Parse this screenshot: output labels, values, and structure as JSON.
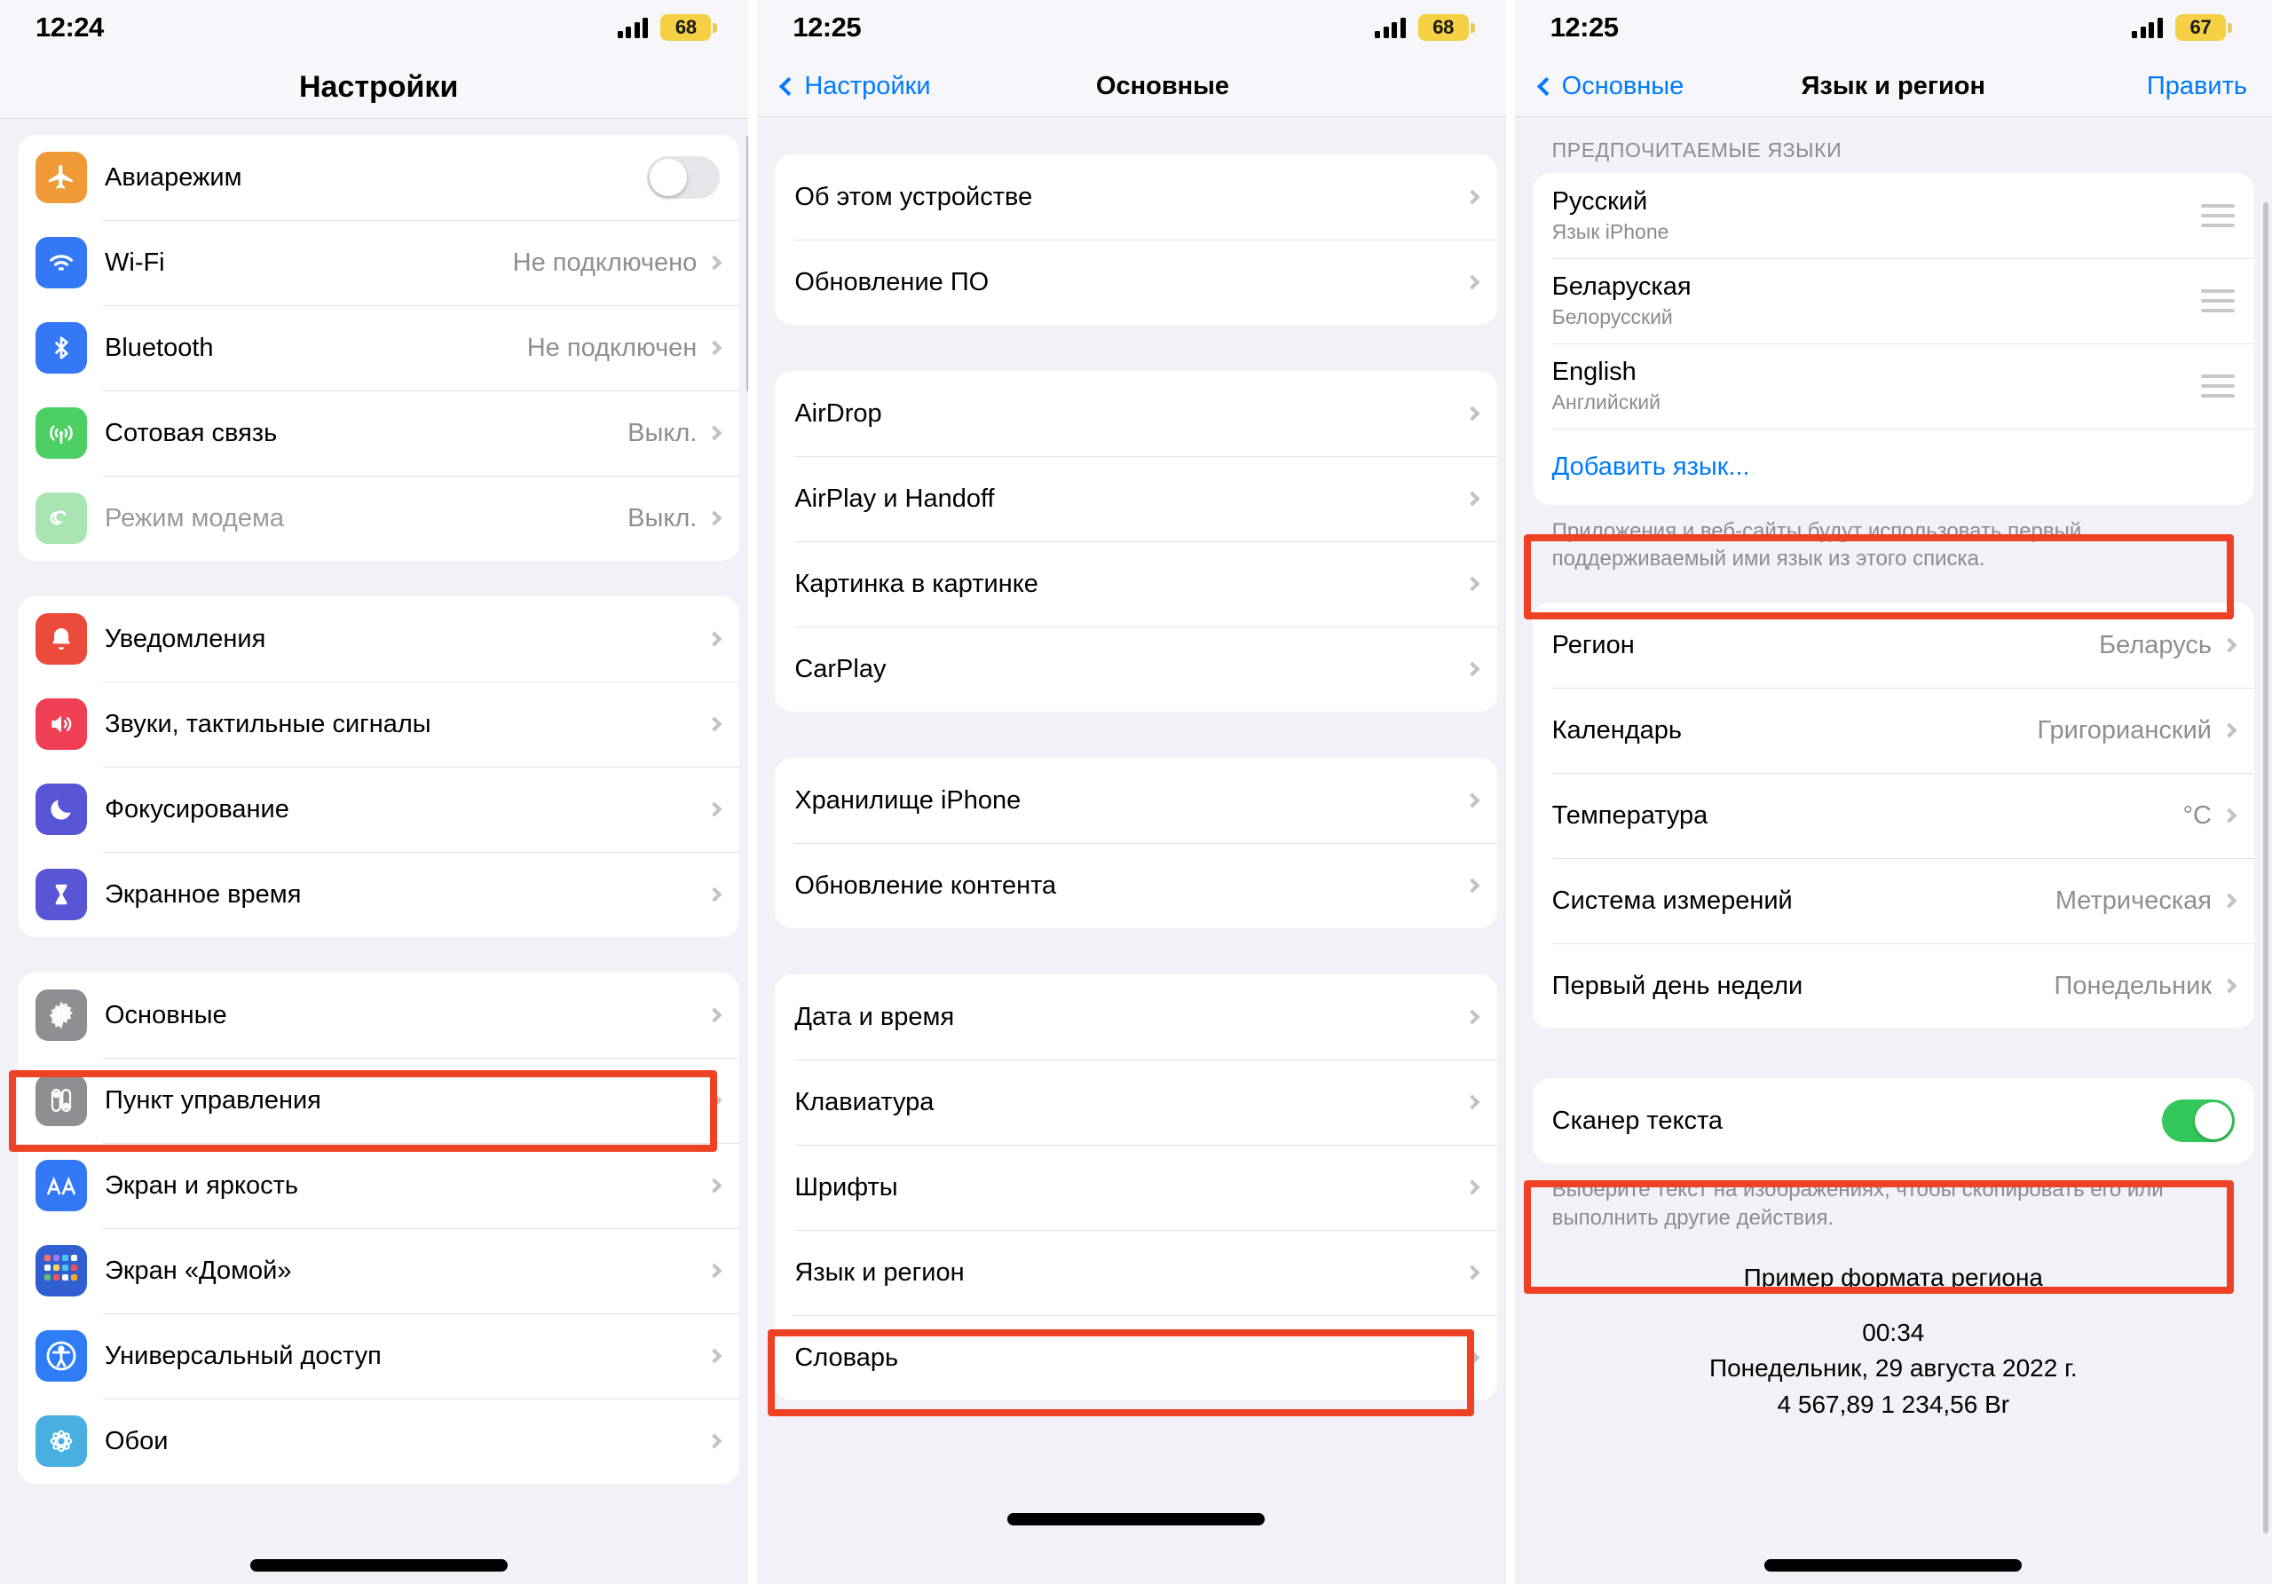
{
  "panels": [
    {
      "id": "settings-root",
      "status": {
        "time": "12:24",
        "battery": "68"
      },
      "nav": {
        "title": "Настройки"
      },
      "groups": [
        {
          "rows": [
            {
              "icon": "airplane-icon",
              "icon_color": "#f09a37",
              "label": "Авиарежим",
              "control": "toggle",
              "toggle_on": false
            },
            {
              "icon": "wifi-icon",
              "icon_color": "#3478f6",
              "label": "Wi-Fi",
              "value": "Не подключено",
              "control": "chevron"
            },
            {
              "icon": "bluetooth-icon",
              "icon_color": "#3478f6",
              "label": "Bluetooth",
              "value": "Не подключен",
              "control": "chevron"
            },
            {
              "icon": "cellular-icon",
              "icon_color": "#4cd063",
              "label": "Сотовая связь",
              "value": "Выкл.",
              "control": "chevron"
            },
            {
              "icon": "hotspot-icon",
              "icon_color": "#a8e5b2",
              "label": "Режим модема",
              "value": "Выкл.",
              "control": "chevron",
              "dim": true
            }
          ]
        },
        {
          "rows": [
            {
              "icon": "bell-icon",
              "icon_color": "#eb4b3b",
              "label": "Уведомления",
              "control": "chevron"
            },
            {
              "icon": "speaker-icon",
              "icon_color": "#ef4056",
              "label": "Звуки, тактильные сигналы",
              "control": "chevron"
            },
            {
              "icon": "moon-icon",
              "icon_color": "#5956d6",
              "label": "Фокусирование",
              "control": "chevron"
            },
            {
              "icon": "hourglass-icon",
              "icon_color": "#5956d6",
              "label": "Экранное время",
              "control": "chevron"
            }
          ]
        },
        {
          "rows": [
            {
              "icon": "gear-icon",
              "icon_color": "#8e8e93",
              "label": "Основные",
              "control": "chevron",
              "highlight": true
            },
            {
              "icon": "control-center-icon",
              "icon_color": "#8e8e93",
              "label": "Пункт управления",
              "control": "chevron"
            },
            {
              "icon": "display-icon",
              "icon_color": "#3478f6",
              "label": "Экран и яркость",
              "control": "chevron"
            },
            {
              "icon": "home-screen-icon",
              "icon_color": "#2f5fd0",
              "label": "Экран «Домой»",
              "control": "chevron"
            },
            {
              "icon": "accessibility-icon",
              "icon_color": "#2f7df6",
              "label": "Универсальный доступ",
              "control": "chevron"
            },
            {
              "icon": "wallpaper-icon",
              "icon_color": "#48b0e0",
              "label": "Обои",
              "control": "chevron"
            }
          ]
        }
      ]
    },
    {
      "id": "general",
      "status": {
        "time": "12:25",
        "battery": "68"
      },
      "nav": {
        "back": "Настройки",
        "title": "Основные"
      },
      "groups": [
        {
          "rows": [
            {
              "label": "Об этом устройстве",
              "control": "chevron"
            },
            {
              "label": "Обновление ПО",
              "control": "chevron"
            }
          ]
        },
        {
          "rows": [
            {
              "label": "AirDrop",
              "control": "chevron"
            },
            {
              "label": "AirPlay и Handoff",
              "control": "chevron"
            },
            {
              "label": "Картинка в картинке",
              "control": "chevron"
            },
            {
              "label": "CarPlay",
              "control": "chevron"
            }
          ]
        },
        {
          "rows": [
            {
              "label": "Хранилище iPhone",
              "control": "chevron"
            },
            {
              "label": "Обновление контента",
              "control": "chevron"
            }
          ]
        },
        {
          "rows": [
            {
              "label": "Дата и время",
              "control": "chevron"
            },
            {
              "label": "Клавиатура",
              "control": "chevron"
            },
            {
              "label": "Шрифты",
              "control": "chevron"
            },
            {
              "label": "Язык и регион",
              "control": "chevron",
              "highlight": true
            },
            {
              "label": "Словарь",
              "control": "chevron"
            }
          ]
        }
      ]
    },
    {
      "id": "language-region",
      "status": {
        "time": "12:25",
        "battery": "67"
      },
      "nav": {
        "back": "Основные",
        "title": "Язык и регион",
        "right": "Править"
      },
      "section_header": "ПРЕДПОЧИТАЕМЫЕ ЯЗЫКИ",
      "languages": [
        {
          "name": "Русский",
          "sub": "Язык iPhone"
        },
        {
          "name": "Беларуская",
          "sub": "Белорусский"
        },
        {
          "name": "English",
          "sub": "Английский"
        }
      ],
      "add_language": "Добавить язык...",
      "languages_footer": "Приложения и веб-сайты будут использовать первый поддерживаемый ими язык из этого списка.",
      "region_rows": [
        {
          "label": "Регион",
          "value": "Беларусь"
        },
        {
          "label": "Календарь",
          "value": "Григорианский"
        },
        {
          "label": "Температура",
          "value": "°C"
        },
        {
          "label": "Система измерений",
          "value": "Метрическая"
        },
        {
          "label": "Первый день недели",
          "value": "Понедельник"
        }
      ],
      "text_scanner": {
        "label": "Сканер текста",
        "on": true
      },
      "text_scanner_footer": "Выберите текст на изображениях, чтобы скопировать его или выполнить другие действия.",
      "sample": {
        "title": "Пример формата региона",
        "lines": [
          "00:34",
          "Понедельник, 29 августа 2022 г.",
          "4 567,89 1 234,56 Br"
        ]
      }
    }
  ],
  "colors": {
    "accent_blue": "#007aff",
    "highlight_red": "#ef4123",
    "toggle_green": "#34c759",
    "battery_yellow": "#f5cf44"
  }
}
